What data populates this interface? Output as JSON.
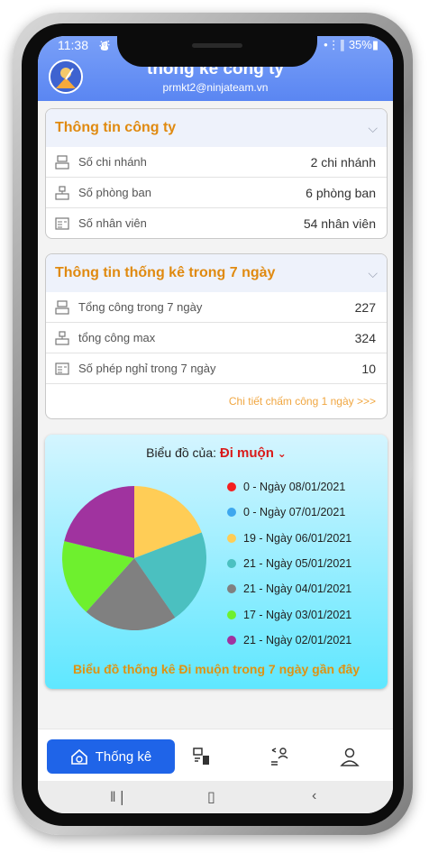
{
  "status": {
    "time": "11:38",
    "indicator": "⛇",
    "signal": "•⋮∥ 35%▮"
  },
  "header": {
    "title": "thông kê công ty",
    "subtitle": "prmkt2@ninjateam.vn"
  },
  "company_card": {
    "title": "Thông tin công ty",
    "rows": [
      {
        "icon": "branch-icon",
        "label": "Số chi nhánh",
        "value": "2 chi nhánh"
      },
      {
        "icon": "department-icon",
        "label": "Số phòng ban",
        "value": "6 phòng ban"
      },
      {
        "icon": "employee-icon",
        "label": "Số nhân viên",
        "value": "54 nhân viên"
      }
    ]
  },
  "stats_card": {
    "title": "Thông tin thống kê trong 7 ngày",
    "rows": [
      {
        "icon": "branch-icon",
        "label": "Tổng công trong 7 ngày",
        "value": "227"
      },
      {
        "icon": "department-icon",
        "label": "tổng công max",
        "value": "324"
      },
      {
        "icon": "employee-icon",
        "label": "Số phép nghỉ trong 7 ngày",
        "value": "10"
      }
    ],
    "link": "Chi tiết chấm công 1 ngày >>>"
  },
  "chart_selector": {
    "label": "Biểu đồ của:",
    "metric": "Đi muộn"
  },
  "chart_data": {
    "type": "pie",
    "title": "Biểu đồ thống kê Đi muộn trong 7 ngày gần đây",
    "slices": [
      {
        "label": "Ngày 08/01/2021",
        "value": 0,
        "color": "#f41f1f"
      },
      {
        "label": "Ngày 07/01/2021",
        "value": 0,
        "color": "#3ea7ee"
      },
      {
        "label": "Ngày 06/01/2021",
        "value": 19,
        "color": "#ffcd56"
      },
      {
        "label": "Ngày 05/01/2021",
        "value": 21,
        "color": "#4bc0c0"
      },
      {
        "label": "Ngày 04/01/2021",
        "value": 21,
        "color": "#808080"
      },
      {
        "label": "Ngày 03/01/2021",
        "value": 17,
        "color": "#6ef02e"
      },
      {
        "label": "Ngày 02/01/2021",
        "value": 21,
        "color": "#a0339f"
      }
    ]
  },
  "nav": {
    "items": [
      {
        "name": "nav-statistics",
        "label": "Thống kê",
        "icon": "home-chart-icon",
        "active": true
      },
      {
        "name": "nav-devices",
        "label": "",
        "icon": "devices-icon",
        "active": false
      },
      {
        "name": "nav-users-sync",
        "label": "",
        "icon": "users-sync-icon",
        "active": false
      },
      {
        "name": "nav-profile",
        "label": "",
        "icon": "user-icon",
        "active": false
      }
    ]
  }
}
